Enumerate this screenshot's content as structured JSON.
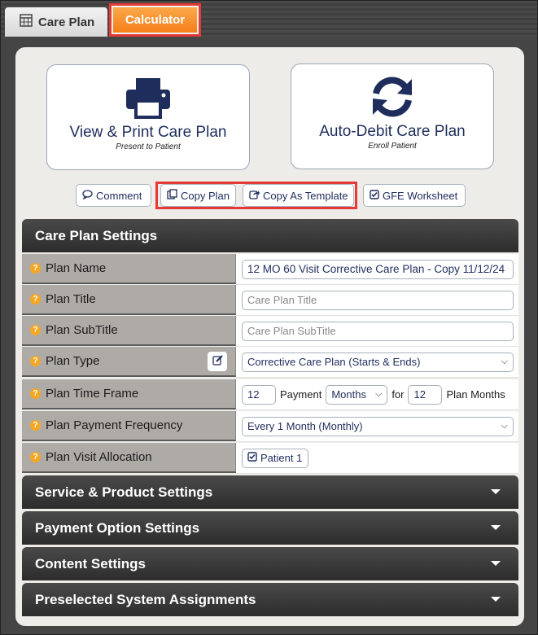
{
  "tabs": {
    "care_plan": "Care Plan",
    "calculator": "Calculator"
  },
  "big_buttons": {
    "view_print": {
      "title": "View & Print Care Plan",
      "subtitle": "Present to Patient",
      "icon": "printer-icon"
    },
    "auto_debit": {
      "title": "Auto-Debit Care Plan",
      "subtitle": "Enroll Patient",
      "icon": "refresh-icon"
    }
  },
  "actions": {
    "comment": "Comment",
    "copy_plan": "Copy Plan",
    "copy_template": "Copy As Template",
    "gfe": "GFE Worksheet"
  },
  "settings": {
    "header": "Care Plan Settings",
    "plan_name_label": "Plan Name",
    "plan_name_value": "12 MO 60 Visit Corrective Care Plan - Copy 11/12/24",
    "plan_title_label": "Plan Title",
    "plan_title_placeholder": "Care Plan Title",
    "plan_subtitle_label": "Plan SubTitle",
    "plan_subtitle_placeholder": "Care Plan SubTitle",
    "plan_type_label": "Plan Type",
    "plan_type_value": "Corrective Care Plan (Starts & Ends)",
    "time_frame_label": "Plan Time Frame",
    "time_frame_count": "12",
    "payment_text": "Payment",
    "payment_unit": "Months",
    "for_text": "for",
    "plan_months_count": "12",
    "plan_months_text": "Plan Months",
    "frequency_label": "Plan Payment Frequency",
    "frequency_value": "Every 1 Month (Monthly)",
    "visit_alloc_label": "Plan Visit Allocation",
    "visit_alloc_value": "Patient 1"
  },
  "sections": {
    "service": "Service & Product Settings",
    "payment": "Payment Option Settings",
    "content": "Content Settings",
    "preselected": "Preselected System Assignments"
  }
}
